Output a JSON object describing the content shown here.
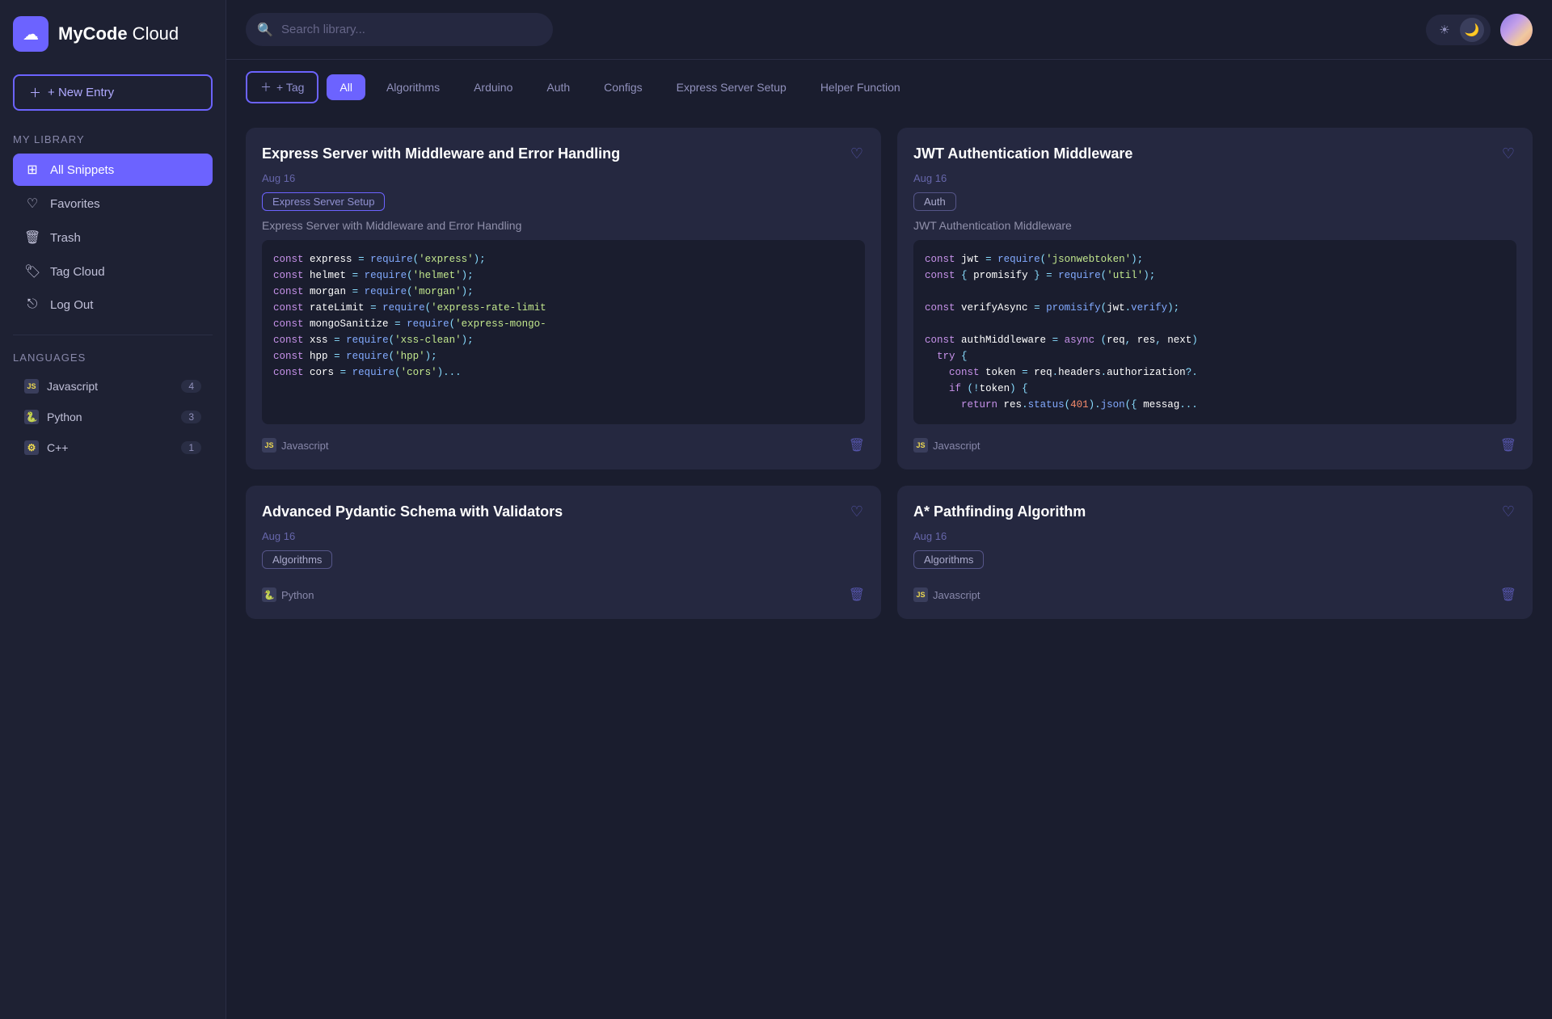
{
  "app": {
    "name_part1": "MyCode",
    "name_part2": " Cloud",
    "logo_icon": "☁"
  },
  "sidebar": {
    "new_entry_label": "+ New Entry",
    "my_library_label": "My Library",
    "nav_items": [
      {
        "id": "all-snippets",
        "label": "All Snippets",
        "icon": "⊞",
        "active": true
      },
      {
        "id": "favorites",
        "label": "Favorites",
        "icon": "♡",
        "active": false
      },
      {
        "id": "trash",
        "label": "Trash",
        "icon": "🗑",
        "active": false
      },
      {
        "id": "tag-cloud",
        "label": "Tag Cloud",
        "icon": "🏷",
        "active": false
      },
      {
        "id": "logout",
        "label": "Log Out",
        "icon": "⎋",
        "active": false
      }
    ],
    "languages_label": "Languages",
    "languages": [
      {
        "id": "javascript",
        "label": "Javascript",
        "icon": "JS",
        "count": "4"
      },
      {
        "id": "python",
        "label": "Python",
        "icon": "🐍",
        "count": "3"
      },
      {
        "id": "cpp",
        "label": "C++",
        "icon": "⚙",
        "count": "1"
      }
    ]
  },
  "topbar": {
    "search_placeholder": "Search library...",
    "theme_light_icon": "☀",
    "theme_dark_icon": "🌙"
  },
  "filter_bar": {
    "tag_button_label": "+ Tag",
    "filters": [
      {
        "id": "all",
        "label": "All",
        "active": true
      },
      {
        "id": "algorithms",
        "label": "Algorithms",
        "active": false
      },
      {
        "id": "arduino",
        "label": "Arduino",
        "active": false
      },
      {
        "id": "auth",
        "label": "Auth",
        "active": false
      },
      {
        "id": "configs",
        "label": "Configs",
        "active": false
      },
      {
        "id": "express-server-setup",
        "label": "Express Server Setup",
        "active": false
      },
      {
        "id": "helper-function",
        "label": "Helper Function",
        "active": false
      }
    ]
  },
  "cards": [
    {
      "id": "card-1",
      "title": "Express Server with Middleware and Error Handling",
      "date": "Aug 16",
      "tag": "Express Server Setup",
      "tag_type": "express",
      "description": "Express Server with Middleware and Error Handling",
      "language": "Javascript",
      "language_type": "js",
      "code_lines": [
        "const express = require('express');",
        "const helmet = require('helmet');",
        "const morgan = require('morgan');",
        "const rateLimit = require('express-rate-limit",
        "const mongoSanitize = require('express-mongo-",
        "const xss = require('xss-clean');",
        "const hpp = require('hpp');",
        "const cors = require('cors')..."
      ]
    },
    {
      "id": "card-2",
      "title": "JWT Authentication Middleware",
      "date": "Aug 16",
      "tag": "Auth",
      "tag_type": "auth",
      "description": "JWT Authentication Middleware",
      "language": "Javascript",
      "language_type": "js",
      "code_lines": [
        "const jwt = require('jsonwebtoken');",
        "const { promisify } = require('util');",
        "",
        "const verifyAsync = promisify(jwt.verify);",
        "",
        "const authMiddleware = async (req, res, next)",
        "  try {",
        "    const token = req.headers.authorization?.",
        "    if (!token) {",
        "      return res.status(401).json({ messag..."
      ]
    },
    {
      "id": "card-3",
      "title": "Advanced Pydantic Schema with Validators",
      "date": "Aug 16",
      "tag": "Algorithms",
      "tag_type": "algo",
      "description": "",
      "language": "Python",
      "language_type": "py",
      "code_lines": []
    },
    {
      "id": "card-4",
      "title": "A* Pathfinding Algorithm",
      "date": "Aug 16",
      "tag": "Algorithms",
      "tag_type": "algo",
      "description": "",
      "language": "Javascript",
      "language_type": "js",
      "code_lines": []
    }
  ]
}
